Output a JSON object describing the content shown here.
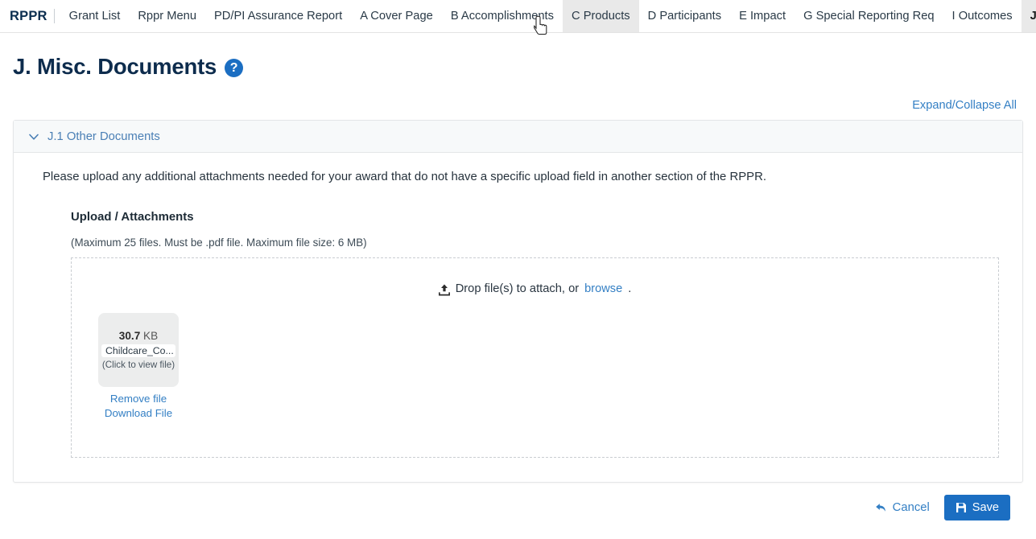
{
  "navbar": {
    "brand": "RPPR",
    "items": [
      {
        "label": "Grant List",
        "state": "normal",
        "name": "nav-grant-list"
      },
      {
        "label": "Rppr Menu",
        "state": "normal",
        "name": "nav-rppr-menu"
      },
      {
        "label": "PD/PI Assurance Report",
        "state": "normal",
        "name": "nav-pdpi-assurance-report"
      },
      {
        "label": "A Cover Page",
        "state": "normal",
        "name": "nav-a-cover-page"
      },
      {
        "label": "B Accomplishments",
        "state": "normal",
        "name": "nav-b-accomplishments"
      },
      {
        "label": "C Products",
        "state": "hovered",
        "name": "nav-c-products"
      },
      {
        "label": "D Participants",
        "state": "normal",
        "name": "nav-d-participants"
      },
      {
        "label": "E Impact",
        "state": "normal",
        "name": "nav-e-impact"
      },
      {
        "label": "G Special Reporting Req",
        "state": "normal",
        "name": "nav-g-special-reporting-req"
      },
      {
        "label": "I Outcomes",
        "state": "normal",
        "name": "nav-i-outcomes"
      },
      {
        "label": "J. Misc. Documents",
        "state": "active",
        "name": "nav-j-misc-documents"
      }
    ]
  },
  "page": {
    "title": "J. Misc. Documents",
    "help_icon": "question-mark-circle-icon",
    "expand_collapse_label": "Expand/Collapse All"
  },
  "section": {
    "chevron_icon": "chevron-down-icon",
    "title": "J.1 Other Documents",
    "instruction": "Please upload any additional attachments needed for your award that do not have a specific upload field in another section of the RPPR."
  },
  "upload": {
    "heading": "Upload / Attachments",
    "constraints": "(Maximum 25 files. Must be .pdf file. Maximum file size: 6 MB)",
    "dropzone_icon": "upload-icon",
    "dropzone_text": "Drop file(s) to attach, or ",
    "dropzone_browse": "browse",
    "dropzone_text_end": ".",
    "files": [
      {
        "size_value": "30.7",
        "size_unit": "KB",
        "name": "Childcare_Co...",
        "hint": "(Click to view file)",
        "remove_label": "Remove file",
        "download_label": "Download File"
      }
    ]
  },
  "footer": {
    "cancel_label": "Cancel",
    "cancel_icon": "back-arrow-icon",
    "save_label": "Save",
    "save_icon": "floppy-disk-icon"
  },
  "colors": {
    "accent_blue": "#1b6ec2",
    "link_blue": "#337fc4",
    "title_navy": "#0d2c4d",
    "panel_header_bg": "#f7f9fa",
    "active_tab_bg": "#e9e9e9"
  }
}
